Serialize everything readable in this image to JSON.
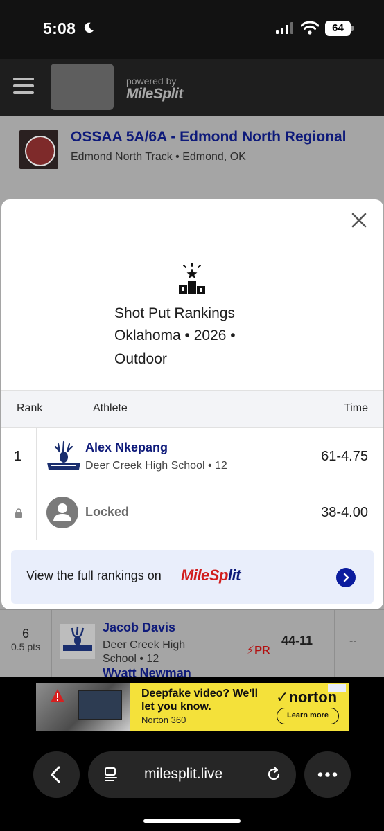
{
  "status_bar": {
    "time": "5:08",
    "battery": "64"
  },
  "app_header": {
    "powered_by": "powered by",
    "brand": "MileSplit"
  },
  "meet": {
    "title": "OSSAA 5A/6A - Edmond North Regional",
    "location": "Edmond North Track • Edmond, OK"
  },
  "background_results": [
    {
      "place": "6",
      "points": "0.5 pts",
      "name": "Jacob Davis",
      "school": "Deer Creek High School • 12",
      "pr": "PR",
      "mark": "44-11",
      "wind": "--"
    },
    {
      "name": "Wyatt Newman"
    }
  ],
  "modal": {
    "title": "Shot Put Rankings",
    "subtitle": "Oklahoma • 2026 • Outdoor",
    "columns": {
      "rank": "Rank",
      "athlete": "Athlete",
      "time": "Time"
    },
    "rows": [
      {
        "rank": "1",
        "name": "Alex Nkepang",
        "school": "Deer Creek High School • 12",
        "time": "61-4.75"
      },
      {
        "name": "Locked",
        "time": "38-4.00"
      }
    ],
    "cta": {
      "text": "View the full rankings on",
      "brand_red": "MileSp",
      "brand_blue": "lit"
    }
  },
  "ad": {
    "headline": "Deepfake video? We'll let you know.",
    "product": "Norton 360",
    "brand": "norton",
    "button": "Learn more"
  },
  "browser": {
    "url": "milesplit.live"
  }
}
